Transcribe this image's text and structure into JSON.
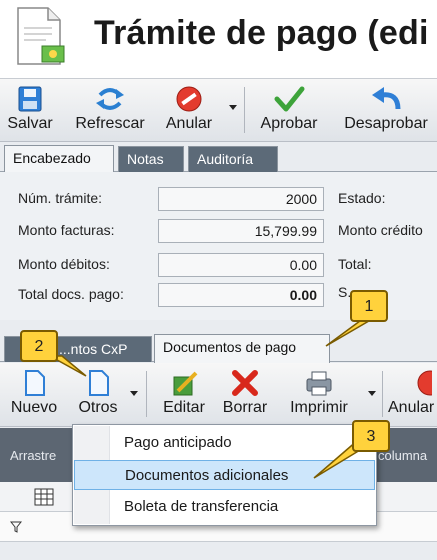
{
  "window": {
    "title": "Trámite de pago (edi"
  },
  "toolbar": {
    "save_label": "Salvar",
    "refresh_label": "Refrescar",
    "cancel_label": "Anular",
    "approve_label": "Aprobar",
    "disapprove_label": "Desaprobar"
  },
  "tabs": {
    "header": "Encabezado",
    "notes": "Notas",
    "audit": "Auditoría"
  },
  "form": {
    "num_tramite_label": "Núm. trámite:",
    "num_tramite_value": "2000",
    "monto_facturas_label": "Monto facturas:",
    "monto_facturas_value": "15,799.99",
    "monto_debitos_label": "Monto débitos:",
    "monto_debitos_value": "0.00",
    "total_docs_label": "Total docs. pago:",
    "total_docs_value": "0.00",
    "estado_label": "Estado:",
    "monto_creditos_label": "Monto crédito",
    "total_label": "Total:",
    "saldo_label": "S..."
  },
  "lower_tabs": {
    "cxp": "...ntos CxP",
    "docs_pago": "Documentos de pago"
  },
  "toolbar2": {
    "new_label": "Nuevo",
    "others_label": "Otros",
    "edit_label": "Editar",
    "delete_label": "Borrar",
    "print_label": "Imprimir",
    "void_label": "Anular"
  },
  "grid": {
    "drag_hint": "Arrastre",
    "column_hint": "columna"
  },
  "menu": {
    "items": [
      "Pago anticipado",
      "Documentos adicionales",
      "Boleta de transferencia"
    ]
  },
  "callouts": {
    "one": "1",
    "two": "2",
    "three": "3"
  },
  "colors": {
    "accent": "#ffd23c",
    "highlight": "#cde6fb",
    "tab_dark": "#5c6a78"
  }
}
